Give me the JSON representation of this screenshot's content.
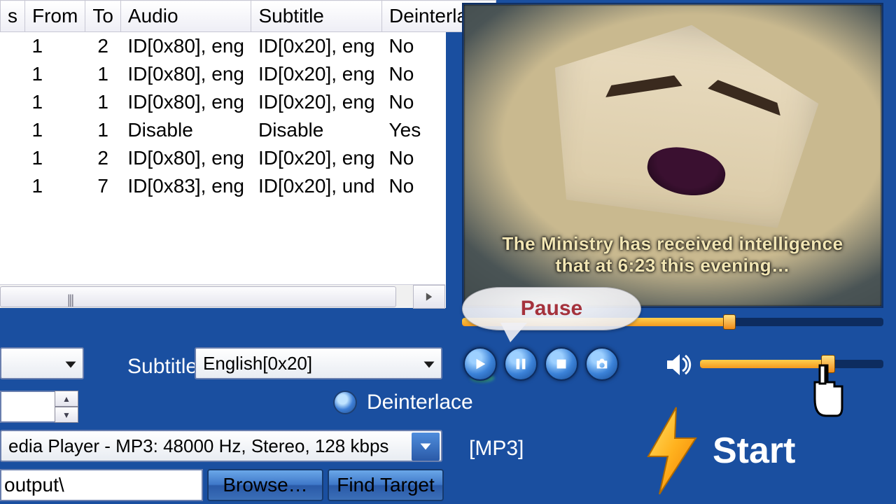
{
  "table": {
    "headers": {
      "from": "From",
      "to": "To",
      "audio": "Audio",
      "subtitle": "Subtitle",
      "deinterlace": "Deinterlace"
    },
    "rows": [
      {
        "from": "1",
        "to": "2",
        "audio": "ID[0x80], eng",
        "subtitle": "ID[0x20], eng",
        "deinterlace": "No"
      },
      {
        "from": "1",
        "to": "1",
        "audio": "ID[0x80], eng",
        "subtitle": "ID[0x20], eng",
        "deinterlace": "No"
      },
      {
        "from": "1",
        "to": "1",
        "audio": "ID[0x80], eng",
        "subtitle": "ID[0x20], eng",
        "deinterlace": "No"
      },
      {
        "from": "1",
        "to": "1",
        "audio": "Disable",
        "subtitle": "Disable",
        "deinterlace": "Yes"
      },
      {
        "from": "1",
        "to": "2",
        "audio": "ID[0x80], eng",
        "subtitle": "ID[0x20], eng",
        "deinterlace": "No"
      },
      {
        "from": "1",
        "to": "7",
        "audio": "ID[0x83], eng",
        "subtitle": "ID[0x20], und",
        "deinterlace": "No"
      }
    ]
  },
  "subtitle": {
    "label": "Subtitle:",
    "value": "English[0x20]"
  },
  "deinterlace_label": "Deinterlace",
  "format": {
    "value": "edia Player - MP3: 48000 Hz, Stereo, 128 kbps"
  },
  "output": {
    "path": "output\\",
    "browse": "Browse…",
    "find": "Find Target"
  },
  "preview": {
    "caption_line1": "The Ministry has received intelligence",
    "caption_line2": "that at 6:23 this evening…"
  },
  "tooltip": "Pause",
  "bracket_format": "[MP3]",
  "start_label": "Start",
  "seek": {
    "percent": 63
  },
  "volume": {
    "percent": 68
  }
}
